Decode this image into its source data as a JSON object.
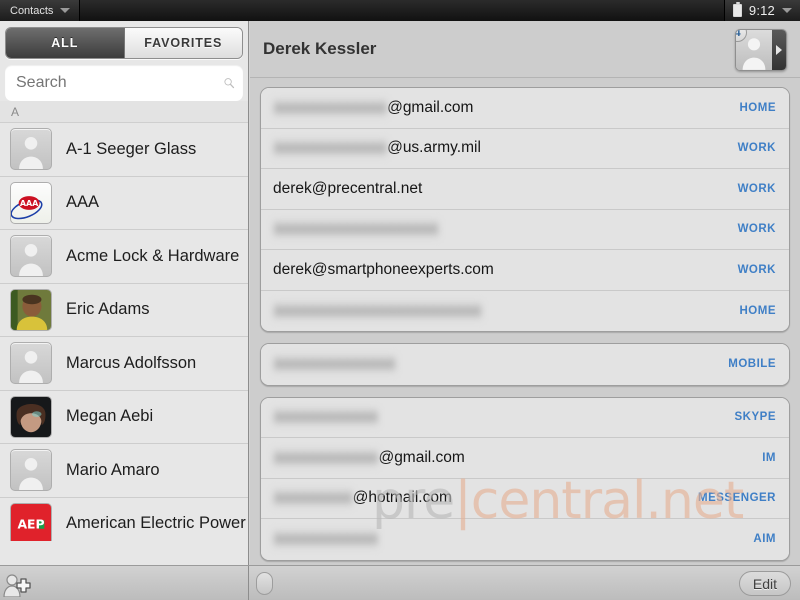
{
  "statusbar": {
    "app_name": "Contacts",
    "time": "9:12",
    "battery_icon": "battery-icon",
    "dropdown_icon": "chevron-down-icon"
  },
  "sidebar": {
    "tabs": [
      {
        "label": "ALL",
        "selected": true
      },
      {
        "label": "FAVORITES",
        "selected": false
      }
    ],
    "search": {
      "value": "",
      "placeholder": "Search",
      "icon": "search-icon"
    },
    "section_header": "A",
    "contacts": [
      {
        "name": "A-1 Seeger Glass",
        "avatar": "default-silhouette"
      },
      {
        "name": "AAA",
        "avatar": "aaa-logo"
      },
      {
        "name": "Acme Lock & Hardware",
        "avatar": "default-silhouette"
      },
      {
        "name": "Eric Adams",
        "avatar": "photo"
      },
      {
        "name": "Marcus Adolfsson",
        "avatar": "default-silhouette"
      },
      {
        "name": "Megan Aebi",
        "avatar": "photo"
      },
      {
        "name": "Mario Amaro",
        "avatar": "default-silhouette"
      },
      {
        "name": "American Electric Power",
        "avatar": "aep-logo"
      }
    ]
  },
  "detail": {
    "name": "Derek Kessler",
    "avatar_badge": "4",
    "avatar_icon": "person-silhouette-icon",
    "expand_icon": "chevron-right-icon",
    "groups": [
      {
        "group_name": "email-addresses",
        "rows": [
          {
            "value": "@gmail.com",
            "redacted_prefix": "aaaaaaaaaaaaa",
            "label": "HOME"
          },
          {
            "value": "@us.army.mil",
            "redacted_prefix": "aaaaaaaaaaaaa",
            "label": "WORK"
          },
          {
            "value": "derek@precentral.net",
            "redacted_prefix": "",
            "label": "WORK"
          },
          {
            "value": "",
            "redacted_prefix": "aaaaaaaaaaaaaaaaaaa",
            "label": "WORK"
          },
          {
            "value": "derek@smartphoneexperts.com",
            "redacted_prefix": "",
            "label": "WORK"
          },
          {
            "value": "",
            "redacted_prefix": "aaaaaaaaaaaaaaaaaaaaaaaa",
            "label": "HOME"
          }
        ]
      },
      {
        "group_name": "phone-numbers",
        "rows": [
          {
            "value": "",
            "redacted_prefix": "aaaaaaaaaaaaaa",
            "label": "MOBILE"
          }
        ]
      },
      {
        "group_name": "instant-messaging",
        "rows": [
          {
            "value": "",
            "redacted_prefix": "aaaaaaaaaaaa",
            "label": "SKYPE"
          },
          {
            "value": "@gmail.com",
            "redacted_prefix": "aaaaaaaaaaaa",
            "label": "IM"
          },
          {
            "value": "@hotmail.com",
            "redacted_prefix": "aaaaaaaaa",
            "label": "MESSENGER"
          },
          {
            "value": "",
            "redacted_prefix": "aaaaaaaaaaaa",
            "label": "AIM"
          }
        ]
      }
    ]
  },
  "watermark": {
    "part1": "pre",
    "part2": "|central.net"
  },
  "bottombar": {
    "add_label": "add-contact",
    "edit_label": "Edit"
  },
  "colors": {
    "accent_link": "#3f7fc6",
    "badge_text": "#2d6298",
    "watermark_gray": "#b9b9b9",
    "watermark_orange": "#e6b094",
    "aaa_red": "#cc1122",
    "aep_red": "#e0222b"
  }
}
